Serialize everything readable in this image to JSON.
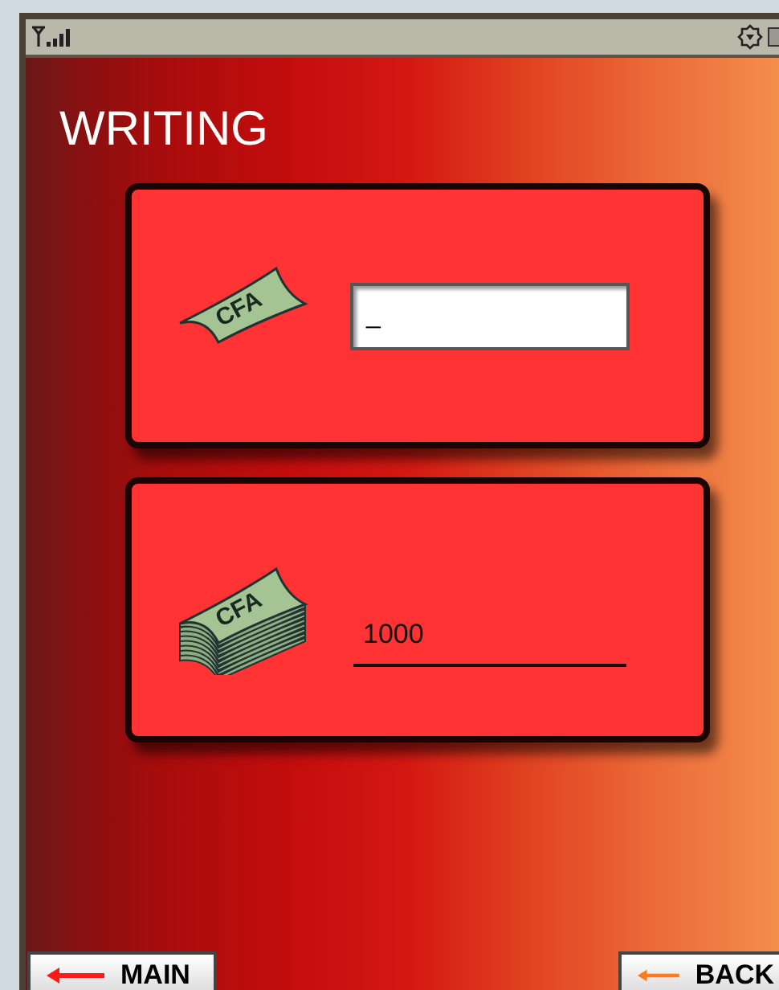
{
  "screen": {
    "title": "WRITING"
  },
  "cards": [
    {
      "kind": "input",
      "icon_text": "CFA",
      "value": "_"
    },
    {
      "kind": "display",
      "icon_text": "CFA",
      "value": "1000"
    }
  ],
  "softkeys": [
    {
      "label": "MAIN",
      "color": "#ff1a1a"
    },
    {
      "label": "BACK",
      "color": "#ff7a1a"
    }
  ]
}
